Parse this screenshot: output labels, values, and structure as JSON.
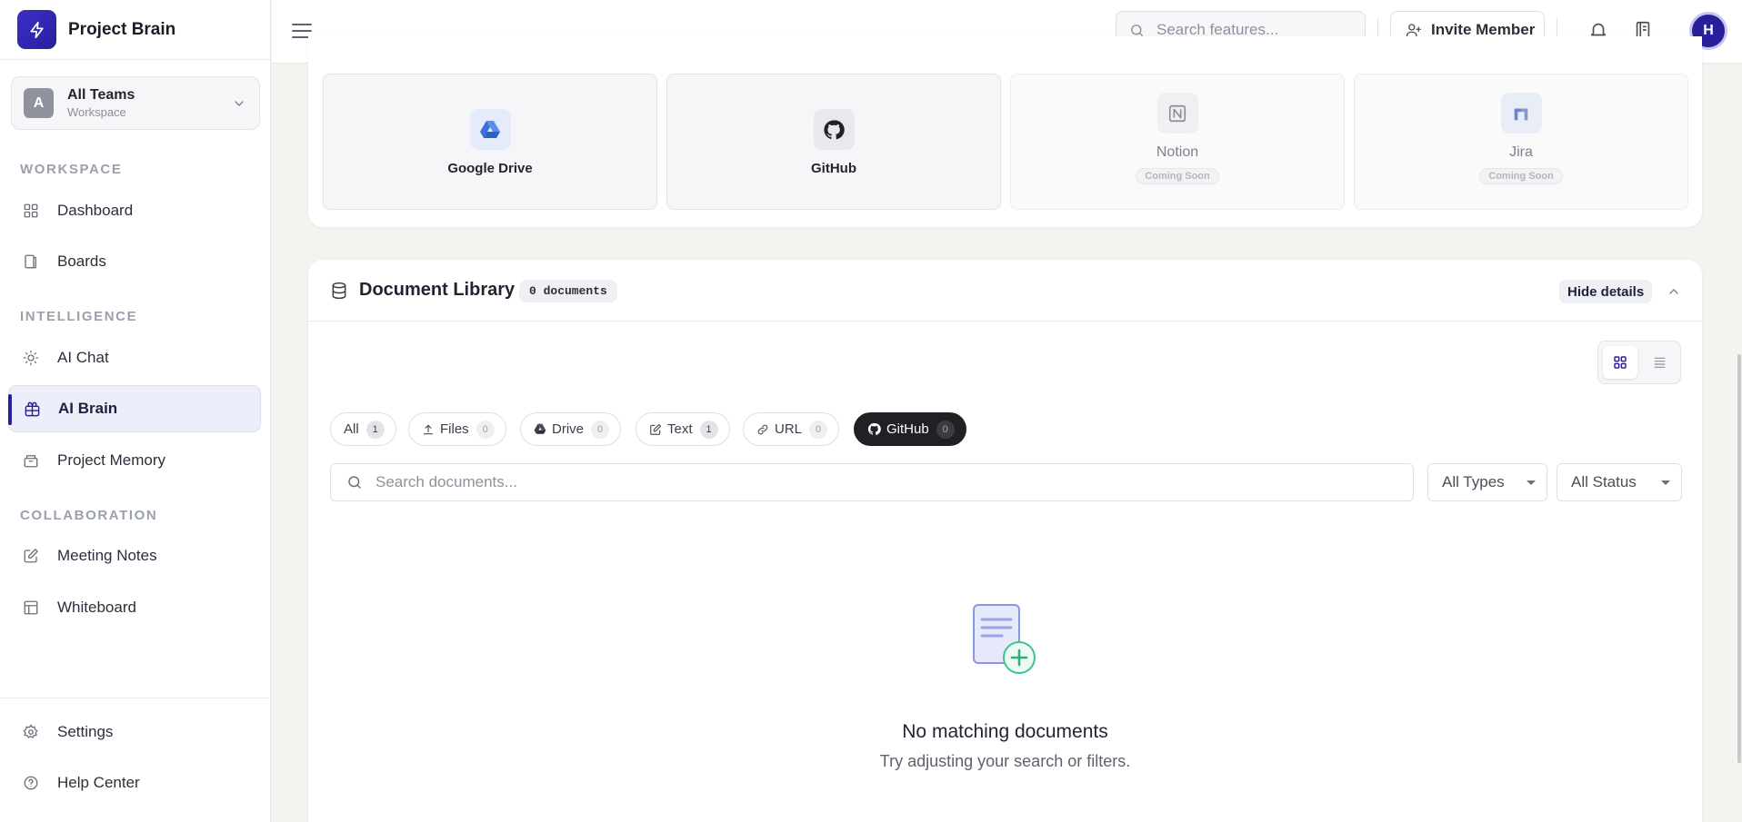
{
  "app": {
    "name": "Project Brain"
  },
  "team": {
    "avatar_letter": "A",
    "name": "All Teams",
    "subtitle": "Workspace"
  },
  "sidebar": {
    "sections": {
      "workspace": "WORKSPACE",
      "intelligence": "INTELLIGENCE",
      "collaboration": "COLLABORATION"
    },
    "items": {
      "dashboard": "Dashboard",
      "boards": "Boards",
      "ai_chat": "AI Chat",
      "ai_brain": "AI Brain",
      "project_memory": "Project Memory",
      "meeting_notes": "Meeting Notes",
      "whiteboard": "Whiteboard",
      "settings": "Settings",
      "help_center": "Help Center"
    },
    "active_item": "AI Brain"
  },
  "topbar": {
    "search_placeholder": "Search features...",
    "invite_label": "Invite Member",
    "user_initial": "H"
  },
  "integrations": [
    {
      "name": "Google Drive",
      "icon": "google-drive-icon",
      "status": ""
    },
    {
      "name": "GitHub",
      "icon": "github-icon",
      "status": ""
    },
    {
      "name": "Notion",
      "icon": "notion-icon",
      "status": "Coming Soon"
    },
    {
      "name": "Jira",
      "icon": "jira-icon",
      "status": "Coming Soon"
    }
  ],
  "library": {
    "title": "Document Library",
    "count_badge": "0 documents",
    "hide_details": "Hide details",
    "filters": [
      {
        "label": "All",
        "count": "1"
      },
      {
        "label": "Files",
        "count": "0"
      },
      {
        "label": "Drive",
        "count": "0"
      },
      {
        "label": "Text",
        "count": "1"
      },
      {
        "label": "URL",
        "count": "0"
      },
      {
        "label": "GitHub",
        "count": "0"
      }
    ],
    "active_filter": "GitHub",
    "search_placeholder": "Search documents...",
    "type_select": "All Types",
    "status_select": "All Status",
    "empty_title": "No matching documents",
    "empty_subtitle": "Try adjusting your search or filters."
  },
  "colors": {
    "brand": "#2a1f9a",
    "active_nav_bg": "#eceefa",
    "active_chip": "#1f2125",
    "empty_plus": "#3cc58a"
  }
}
